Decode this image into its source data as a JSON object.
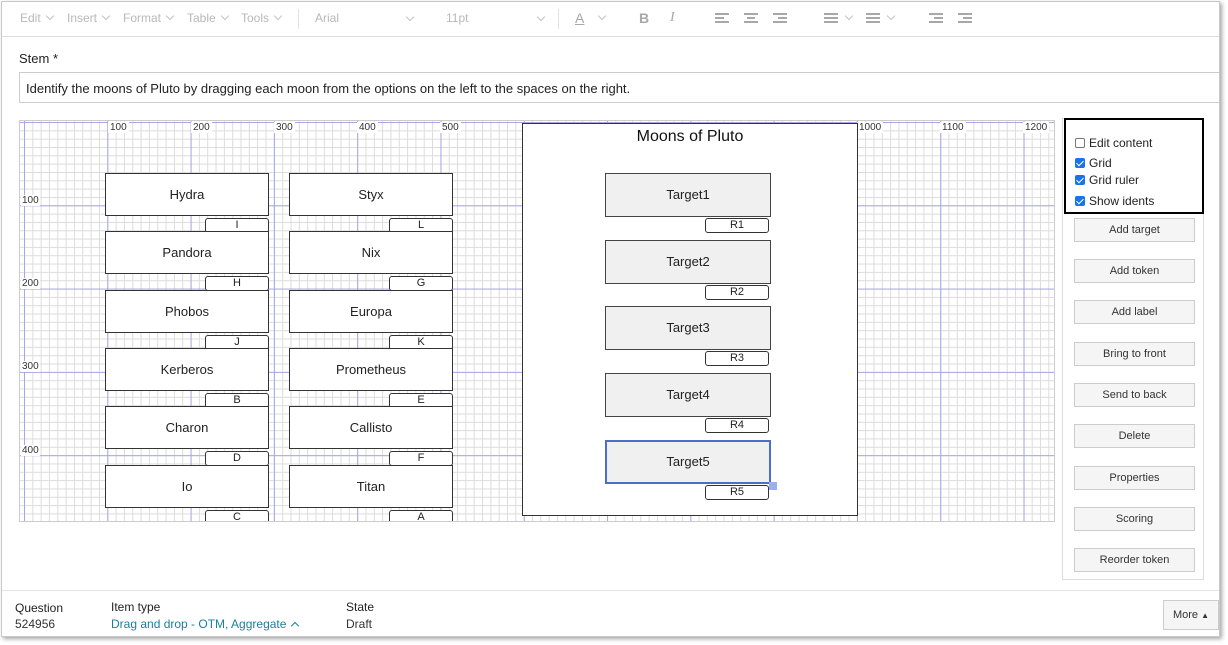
{
  "toolbar": {
    "menus": [
      "Edit",
      "Insert",
      "Format",
      "Table",
      "Tools"
    ],
    "font_family": "Arial",
    "font_size": "11pt",
    "font_color_label": "A",
    "bold_label": "B",
    "italic_label": "I"
  },
  "stem": {
    "label": "Stem *",
    "text": "Identify the moons of Pluto by dragging each moon from the options on the left to the spaces on the right."
  },
  "canvas": {
    "ruler_x": [
      "100",
      "200",
      "300",
      "400",
      "500",
      "1000",
      "1100",
      "1200"
    ],
    "ruler_y": [
      "100",
      "200",
      "300",
      "400"
    ],
    "tokens_left": [
      {
        "label": "Hydra",
        "ident": "I"
      },
      {
        "label": "Pandora",
        "ident": "H"
      },
      {
        "label": "Phobos",
        "ident": "J"
      },
      {
        "label": "Kerberos",
        "ident": "B"
      },
      {
        "label": "Charon",
        "ident": "D"
      },
      {
        "label": "Io",
        "ident": "C"
      }
    ],
    "tokens_right": [
      {
        "label": "Styx",
        "ident": "L"
      },
      {
        "label": "Nix",
        "ident": "G"
      },
      {
        "label": "Europa",
        "ident": "K"
      },
      {
        "label": "Prometheus",
        "ident": "E"
      },
      {
        "label": "Callisto",
        "ident": "F"
      },
      {
        "label": "Titan",
        "ident": "A"
      }
    ],
    "panel_title": "Moons of Pluto",
    "targets": [
      {
        "label": "Target1",
        "ident": "R1"
      },
      {
        "label": "Target2",
        "ident": "R2"
      },
      {
        "label": "Target3",
        "ident": "R3"
      },
      {
        "label": "Target4",
        "ident": "R4"
      },
      {
        "label": "Target5",
        "ident": "R5"
      }
    ]
  },
  "options": {
    "edit_content": {
      "label": "Edit content",
      "checked": false
    },
    "grid": {
      "label": "Grid",
      "checked": true
    },
    "grid_ruler": {
      "label": "Grid ruler",
      "checked": true
    },
    "show_idents": {
      "label": "Show idents",
      "checked": true
    }
  },
  "side_buttons": [
    "Add target",
    "Add token",
    "Add label",
    "Bring to front",
    "Send to back",
    "Delete",
    "Properties",
    "Scoring",
    "Reorder token"
  ],
  "footer": {
    "question_label": "Question",
    "question_id": "524956",
    "item_type_label": "Item type",
    "item_type_value": "Drag and drop - OTM, Aggregate",
    "state_label": "State",
    "state_value": "Draft",
    "more_label": "More"
  },
  "colors": {
    "selected_border": "#4a6fc4",
    "link": "#1a7fa0",
    "checkbox": "#1a73e8"
  }
}
